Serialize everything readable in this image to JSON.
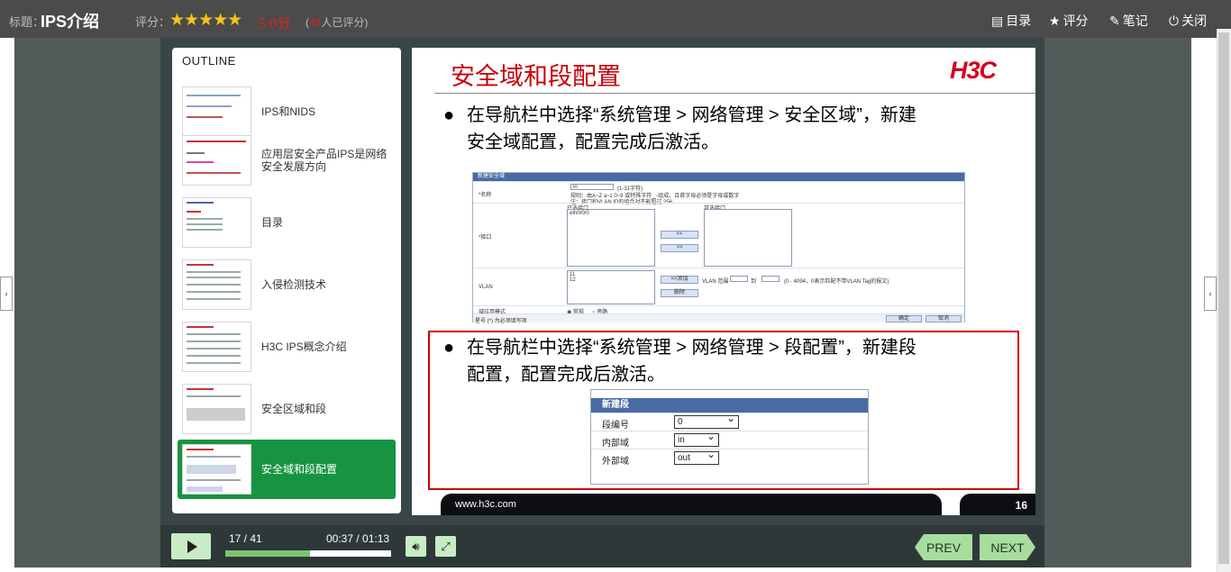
{
  "header": {
    "title_label": "标题：",
    "title": "IPS介绍",
    "rating_label": "评分：",
    "stars": "★★★★★",
    "star_color": "#f5c518",
    "score": "5.0分",
    "rating_count_prefix": "(",
    "rating_count": "45",
    "rating_count_suffix": "人已评分)",
    "buttons": {
      "catalog": "目录",
      "rate": "评分",
      "notes": "笔记",
      "close": "关闭"
    },
    "icons": {
      "catalog": "list-icon",
      "rate": "star-icon",
      "notes": "pencil-icon",
      "close": "power-icon"
    }
  },
  "outline": {
    "heading": "OUTLINE",
    "items": [
      {
        "label": "IPS和NIDS"
      },
      {
        "label": "应用层安全产品IPS是网络安全发展方向"
      },
      {
        "label": "目录"
      },
      {
        "label": "入侵检测技术"
      },
      {
        "label": "H3C IPS概念介绍"
      },
      {
        "label": "安全区域和段"
      },
      {
        "label": "安全域和段配置",
        "active": true
      }
    ],
    "active_color": "#169441"
  },
  "slide": {
    "title": "安全域和段配置",
    "logo": "H3C",
    "bullet1_line1": "在导航栏中选择“系统管理 > 网络管理 > 安全区域”，新建",
    "bullet1_line2": "安全域配置，配置完成后激活。",
    "bullet2_line1": "在导航栏中选择“系统管理 > 网络管理 > 段配置”，新建段",
    "bullet2_line2": "配置，配置完成后激活。",
    "screenshot1": {
      "header": "新建安全域",
      "name_label": "*名称",
      "name_value": "in",
      "name_hint": "(1-31字符)",
      "rule1": "规则：由A~Z a~z 0~9 或特殊字符_ -组成，且首字母必须是字母或数字",
      "rule2": "注：接口和VLAN ID的组合对不能超过 256",
      "selected_if_label": "已选接口",
      "available_if_label": "可选接口",
      "selected_if_value": "eth0/0/0",
      "if_label": "*接口",
      "btn_left": "<<",
      "btn_right": ">>",
      "vlan_label": "VLAN",
      "vlan_values": [
        "11",
        "12"
      ],
      "vlan_add": "<<添加",
      "vlan_range": "VLAN 范围",
      "vlan_to": "到",
      "vlan_hint": "(0 - 4094，0表示匹配不带VLAN Tag的报文)",
      "vlan_delete": "删除",
      "mode_label": "域应用模式",
      "mode_opt1": "常规",
      "mode_opt2": "旁路",
      "required_note": "星号 (*) 为必须填写项",
      "ok": "确定",
      "cancel": "取消"
    },
    "screenshot2": {
      "header": "新建段",
      "rows": [
        {
          "key": "段编号",
          "value": "0"
        },
        {
          "key": "内部域",
          "value": "in"
        },
        {
          "key": "外部域",
          "value": "out"
        }
      ]
    },
    "footer_url": "www.h3c.com",
    "page_number": "16"
  },
  "controls": {
    "slide_counter": "17 / 41",
    "time": "00:37 / 01:13",
    "progress": 0.51,
    "prev": "PREV",
    "next": "NEXT",
    "icons": {
      "play": "play-icon",
      "volume": "volume-icon",
      "fullscreen": "fullscreen-icon"
    }
  }
}
